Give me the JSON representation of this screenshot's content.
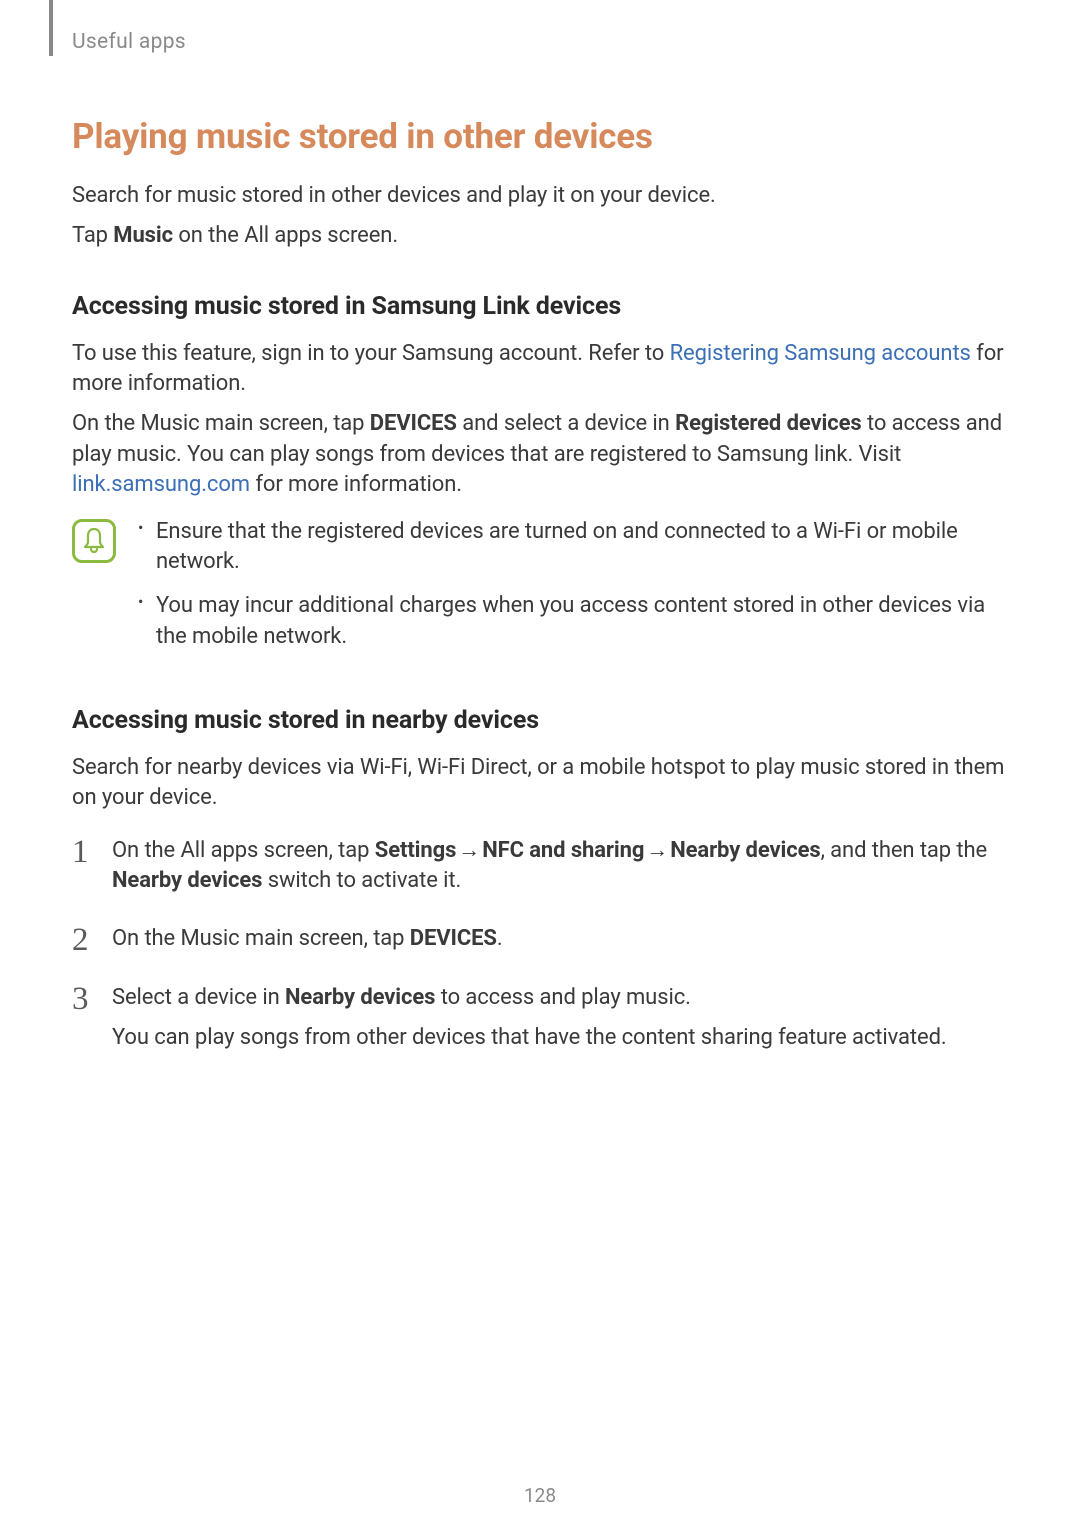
{
  "header": {
    "breadcrumb": "Useful apps"
  },
  "h1": "Playing music stored in other devices",
  "intro1": "Search for music stored in other devices and play it on your device.",
  "intro2_pre": "Tap ",
  "intro2_bold": "Music",
  "intro2_post": " on the All apps screen.",
  "section1": {
    "heading": "Accessing music stored in Samsung Link devices",
    "p1_pre": "To use this feature, sign in to your Samsung account. Refer to ",
    "p1_link": "Registering Samsung accounts",
    "p1_post": " for more information.",
    "p2_pre": "On the Music main screen, tap ",
    "p2_bold1": "DEVICES",
    "p2_mid1": " and select a device in ",
    "p2_bold2": "Registered devices",
    "p2_mid2": " to access and play music. You can play songs from devices that are registered to Samsung link. Visit ",
    "p2_link": "link.samsung.com",
    "p2_post": " for more information.",
    "note1": "Ensure that the registered devices are turned on and connected to a Wi-Fi or mobile network.",
    "note2": "You may incur additional charges when you access content stored in other devices via the mobile network."
  },
  "section2": {
    "heading": "Accessing music stored in nearby devices",
    "p1": "Search for nearby devices via Wi-Fi, Wi-Fi Direct, or a mobile hotspot to play music stored in them on your device.",
    "steps": {
      "s1": {
        "num": "1",
        "pre": "On the All apps screen, tap ",
        "b1": "Settings",
        "arr1": " → ",
        "b2": "NFC and sharing",
        "arr2": " → ",
        "b3": "Nearby devices",
        "mid": ", and then tap the ",
        "b4": "Nearby devices",
        "post": " switch to activate it."
      },
      "s2": {
        "num": "2",
        "pre": "On the Music main screen, tap ",
        "b1": "DEVICES",
        "post": "."
      },
      "s3": {
        "num": "3",
        "pre": "Select a device in ",
        "b1": "Nearby devices",
        "post": " to access and play music.",
        "sub": "You can play songs from other devices that have the content sharing feature activated."
      }
    }
  },
  "pageNumber": "128"
}
